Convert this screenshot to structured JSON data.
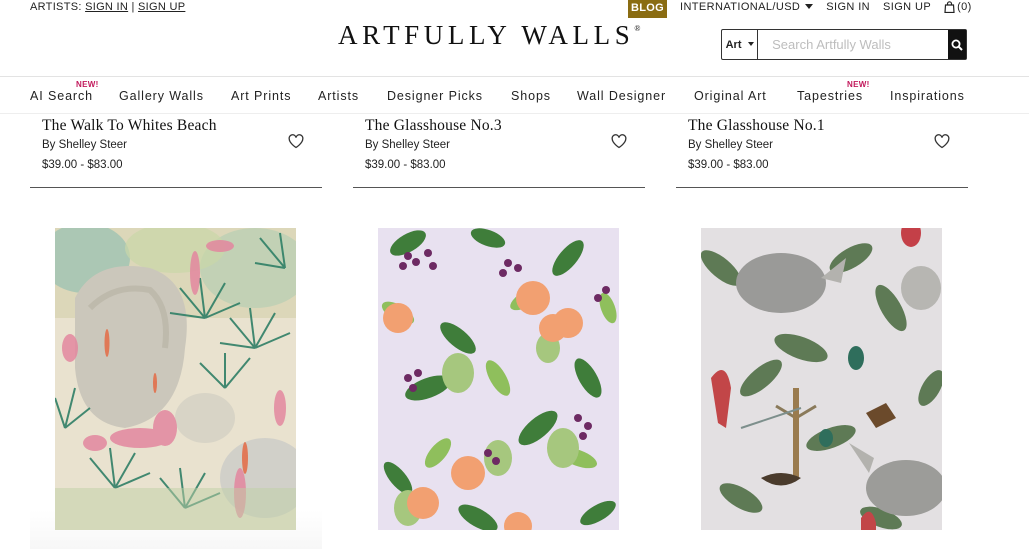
{
  "topbar": {
    "artists_label": "ARTISTS:",
    "sign_in": "SIGN IN",
    "separator": "|",
    "sign_up": "SIGN UP",
    "blog": "BLOG",
    "currency": "INTERNATIONAL/USD",
    "account_sign_in": "SIGN IN",
    "account_sign_up": "SIGN UP",
    "cart": "(0)"
  },
  "logo": {
    "text": "ARTFULLY WALLS",
    "mark": "®"
  },
  "search": {
    "category": "Art",
    "placeholder": "Search Artfully Walls"
  },
  "nav": {
    "items": [
      {
        "label": "AI Search",
        "badge": "NEW!"
      },
      {
        "label": "Gallery Walls"
      },
      {
        "label": "Art Prints"
      },
      {
        "label": "Artists"
      },
      {
        "label": "Designer Picks"
      },
      {
        "label": "Shops"
      },
      {
        "label": "Wall Designer"
      },
      {
        "label": "Original Art"
      },
      {
        "label": "Tapestries",
        "badge": "NEW!"
      },
      {
        "label": "Inspirations"
      }
    ]
  },
  "products": [
    {
      "title": "The Walk To Whites Beach",
      "artist": "By Shelley Steer",
      "price": "$39.00 - $83.00"
    },
    {
      "title": "The Glasshouse No.3",
      "artist": "By Shelley Steer",
      "price": "$39.00 - $83.00"
    },
    {
      "title": "The Glasshouse No.1",
      "artist": "By Shelley Steer",
      "price": "$39.00 - $83.00"
    }
  ],
  "colors": {
    "blog_bg": "#8a6c12",
    "new_badge": "#c2185b",
    "search_button": "#111111"
  }
}
